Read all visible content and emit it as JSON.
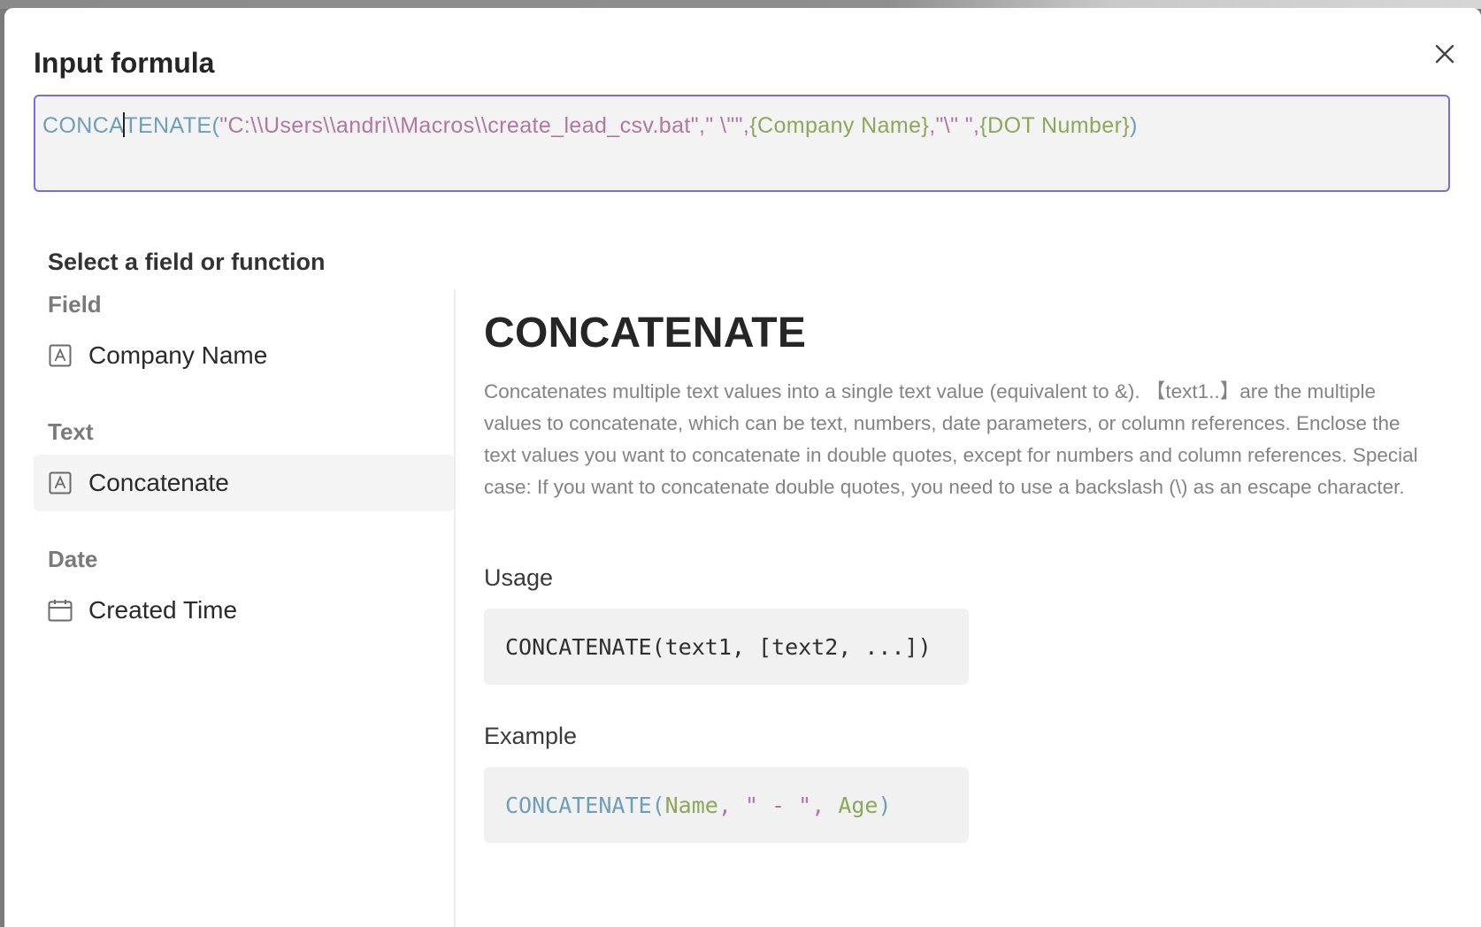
{
  "dialog": {
    "title": "Input formula",
    "close_icon": "close-icon"
  },
  "formula": {
    "fn_before_caret": "CONCA",
    "fn_after_caret": "TENATE(",
    "str1": "\"C:\\\\Users\\\\andri\\\\Macros\\\\create_lead_csv.bat\",\" \\\"\",",
    "field1": "{Company Name}",
    "str2": ",\"\\\" \",",
    "field2": "{DOT Number}",
    "close_paren": ")"
  },
  "picker": {
    "label": "Select a field or function",
    "groups": [
      {
        "title": "Field",
        "items": [
          {
            "label": "Company Name",
            "icon": "text-field-icon",
            "selected": false
          }
        ]
      },
      {
        "title": "Text",
        "items": [
          {
            "label": "Concatenate",
            "icon": "text-field-icon",
            "selected": true
          }
        ]
      },
      {
        "title": "Date",
        "items": [
          {
            "label": "Created Time",
            "icon": "calendar-icon",
            "selected": false
          }
        ]
      }
    ]
  },
  "detail": {
    "title": "CONCATENATE",
    "description": "Concatenates multiple text values into a single text value (equivalent to &). 【text1..】are the multiple values to concatenate, which can be text, numbers, date parameters, or column references. Enclose the text values you want to concatenate in double quotes, except for numbers and column references. Special case: If you want to concatenate double quotes, you need to use a backslash (\\) as an escape character.",
    "usage_label": "Usage",
    "usage_code": "CONCATENATE(text1, [text2, ...])",
    "example_label": "Example",
    "example": {
      "fn": "CONCATENATE(",
      "arg1": "Name",
      "sep1": ", ",
      "str": "\" - \"",
      "sep2": ", ",
      "arg2": "Age",
      "close": ")"
    }
  },
  "colors": {
    "accent_border": "#7b6cd9",
    "function": "#6e9fb8",
    "string": "#b0789e",
    "field": "#8fa65a"
  }
}
